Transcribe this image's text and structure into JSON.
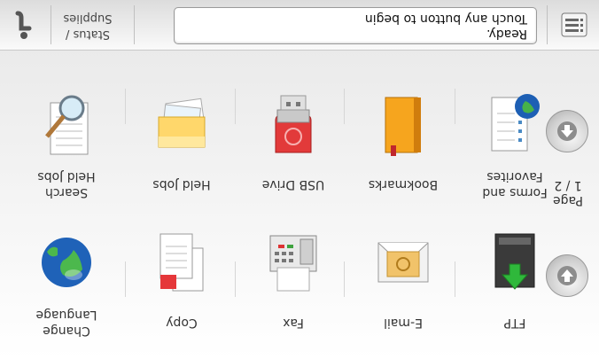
{
  "header": {
    "info_label": "i",
    "status_lines": [
      "Status /",
      "Supplies"
    ],
    "message_lines": [
      "Ready.",
      "Touch any button to begin"
    ],
    "menu_icon": "list-menu-icon"
  },
  "tiles": [
    {
      "id": "search-held-jobs",
      "lines": [
        "Search",
        "Held Jobs"
      ],
      "icon": "magnifier-on-document-icon"
    },
    {
      "id": "held-jobs",
      "lines": [
        "Held Jobs"
      ],
      "icon": "folder-stack-icon"
    },
    {
      "id": "usb-drive",
      "lines": [
        "USB Drive"
      ],
      "icon": "usb-drive-icon"
    },
    {
      "id": "bookmarks",
      "lines": [
        "Bookmarks"
      ],
      "icon": "bookmark-folder-icon"
    },
    {
      "id": "forms-favorites",
      "lines": [
        "Forms and",
        "Favorites"
      ],
      "icon": "document-globe-icon"
    },
    {
      "id": "change-language",
      "lines": [
        "Change",
        "Language"
      ],
      "icon": "globe-icon"
    },
    {
      "id": "copy",
      "lines": [
        "Copy"
      ],
      "icon": "copy-documents-icon"
    },
    {
      "id": "fax",
      "lines": [
        "Fax"
      ],
      "icon": "fax-machine-icon"
    },
    {
      "id": "email",
      "lines": [
        "E-mail"
      ],
      "icon": "envelope-icon"
    },
    {
      "id": "ftp",
      "lines": [
        "FTP"
      ],
      "icon": "ftp-server-icon"
    }
  ],
  "pager": {
    "lines": [
      "Page",
      "1 / 2"
    ],
    "up_icon": "arrow-up-icon",
    "down_icon": "arrow-down-icon"
  }
}
